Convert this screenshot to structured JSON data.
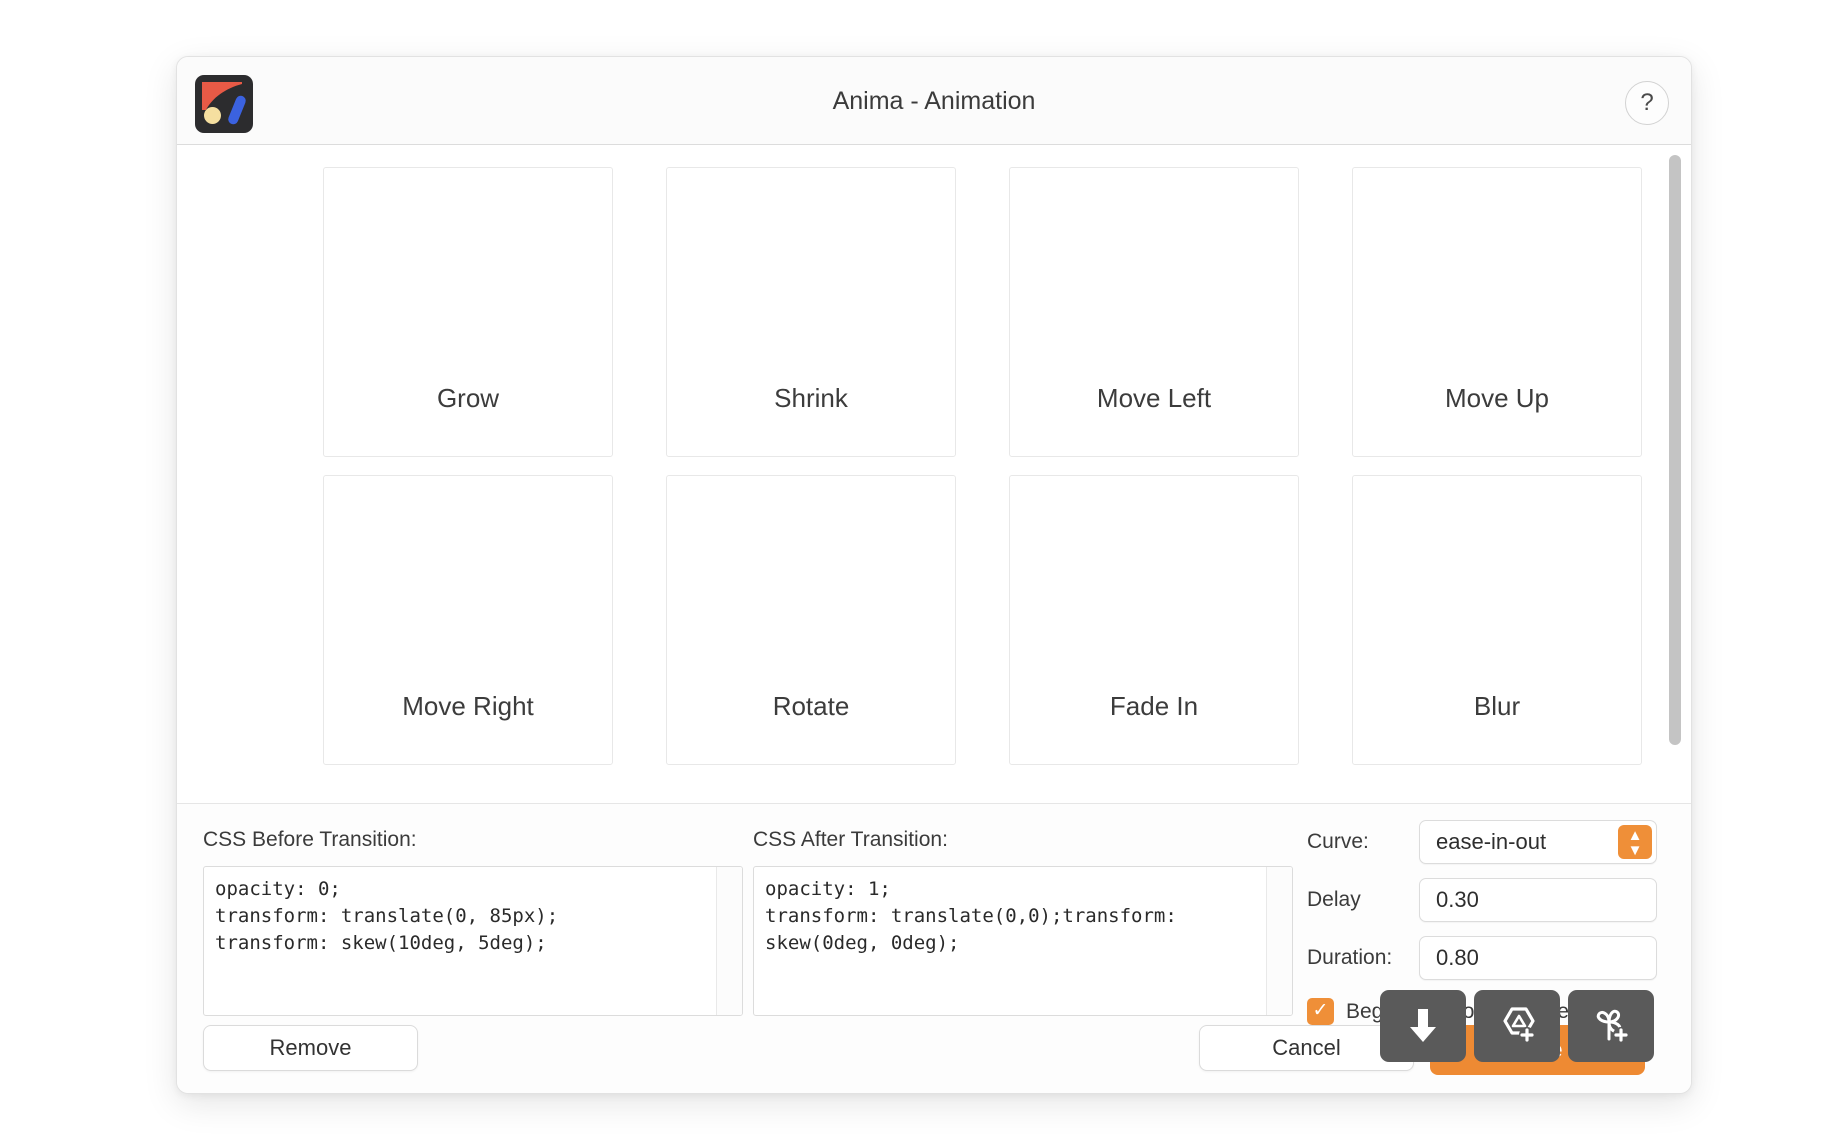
{
  "window": {
    "title": "Anima - Animation",
    "app_icon": "anima-logo-icon",
    "help_label": "?"
  },
  "animations": {
    "cells": [
      {
        "label": "Grow"
      },
      {
        "label": "Shrink"
      },
      {
        "label": "Move Left"
      },
      {
        "label": "Move Up"
      },
      {
        "label": "Move Right"
      },
      {
        "label": "Rotate"
      },
      {
        "label": "Fade In"
      },
      {
        "label": "Blur"
      }
    ]
  },
  "css_before": {
    "label": "CSS Before Transition:",
    "value": "opacity: 0;\ntransform: translate(0, 85px);\ntransform: skew(10deg, 5deg);"
  },
  "css_after": {
    "label": "CSS After Transition:",
    "value": "opacity: 1;\ntransform: translate(0,0);transform: skew(0deg, 0deg);"
  },
  "settings": {
    "curve_label": "Curve:",
    "curve_value": "ease-in-out",
    "delay_label": "Delay",
    "delay_value": "0.30",
    "duration_label": "Duration:",
    "duration_value": "0.80",
    "begin_on_scroll_label": "Begin on scroll into screen",
    "begin_on_scroll_checked": "✓"
  },
  "footer": {
    "remove_label": "Remove",
    "cancel_label": "Cancel",
    "save_label": "Save"
  },
  "overlay_toolbar": {
    "buttons": [
      {
        "icon": "download-arrow-icon"
      },
      {
        "icon": "add-component-icon"
      },
      {
        "icon": "add-plugin-icon"
      }
    ]
  },
  "colors": {
    "accent_orange": "#ee8a33",
    "stepper_orange": "#ef8f38",
    "overlay_gray": "#5a5a5a",
    "icon_red": "#e85a46",
    "icon_blue": "#3b62e0",
    "icon_yellow": "#f5dfa0"
  }
}
